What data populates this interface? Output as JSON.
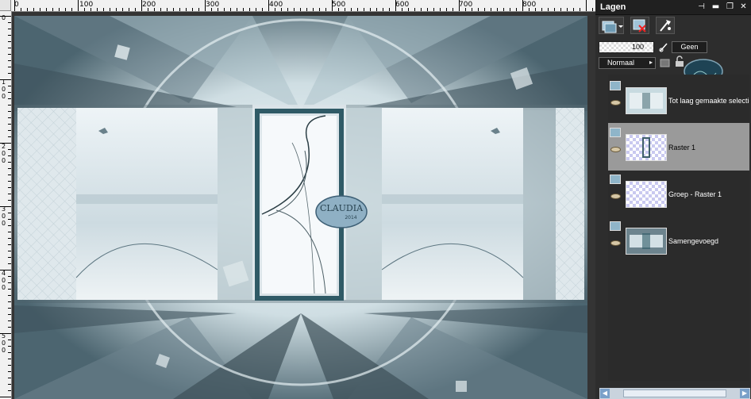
{
  "rulers": {
    "top": [
      "0",
      "100",
      "200",
      "300",
      "400",
      "500",
      "600",
      "700",
      "800"
    ],
    "left": [
      "0",
      "100",
      "200",
      "300",
      "400",
      "500"
    ]
  },
  "canvas": {
    "colors": {
      "base": "#b9ccd1",
      "dark": "#3c4a52",
      "accent": "#2f5a66",
      "light": "#eef4f6"
    },
    "watermark": {
      "name": "CLAUDIA",
      "sub": "2014"
    }
  },
  "panel": {
    "title": "Lagen",
    "window_buttons": {
      "pin": "⊣",
      "minimize": "▬",
      "restore": "❐",
      "close": "✕"
    },
    "toolbar": [
      {
        "name": "new-layer-icon"
      },
      {
        "name": "delete-layer-icon"
      },
      {
        "name": "layer-properties-icon"
      }
    ],
    "opacity": "100",
    "mask_label": "Geen",
    "blend_mode": "Normaal",
    "layers": [
      {
        "name": "Tot laag gemaakte selectie",
        "selected": false,
        "thumb": "canvas"
      },
      {
        "name": "Raster 1",
        "selected": true,
        "thumb": "frame"
      },
      {
        "name": "Groep - Raster 1",
        "selected": false,
        "thumb": "empty"
      },
      {
        "name": "Samengevoegd",
        "selected": false,
        "thumb": "canvas-dark"
      }
    ]
  }
}
